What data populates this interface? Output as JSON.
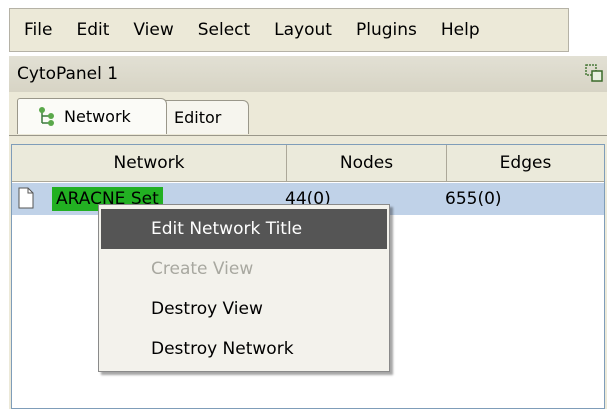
{
  "menubar": {
    "items": [
      {
        "label": "File"
      },
      {
        "label": "Edit"
      },
      {
        "label": "View"
      },
      {
        "label": "Select"
      },
      {
        "label": "Layout"
      },
      {
        "label": "Plugins"
      },
      {
        "label": "Help"
      }
    ]
  },
  "panel": {
    "title": "CytoPanel 1",
    "float_icon": "float-window-icon"
  },
  "tabs": [
    {
      "label": "Network",
      "icon": "network-tree-icon",
      "selected": true
    },
    {
      "label": "Editor",
      "selected": false
    }
  ],
  "table": {
    "columns": [
      "Network",
      "Nodes",
      "Edges"
    ],
    "rows": [
      {
        "icon": "document-icon",
        "name": "ARACNE Set",
        "nodes": "44(0)",
        "edges": "655(0)"
      }
    ]
  },
  "context_menu": {
    "items": [
      {
        "label": "Edit Network Title",
        "state": "highlighted"
      },
      {
        "label": "Create View",
        "state": "disabled"
      },
      {
        "label": "Destroy View",
        "state": "enabled"
      },
      {
        "label": "Destroy Network",
        "state": "enabled"
      }
    ]
  },
  "colors": {
    "selected_name_bg": "#22b022",
    "row_selection_bg": "#c0d2e8",
    "menu_highlight_bg": "#555555"
  }
}
